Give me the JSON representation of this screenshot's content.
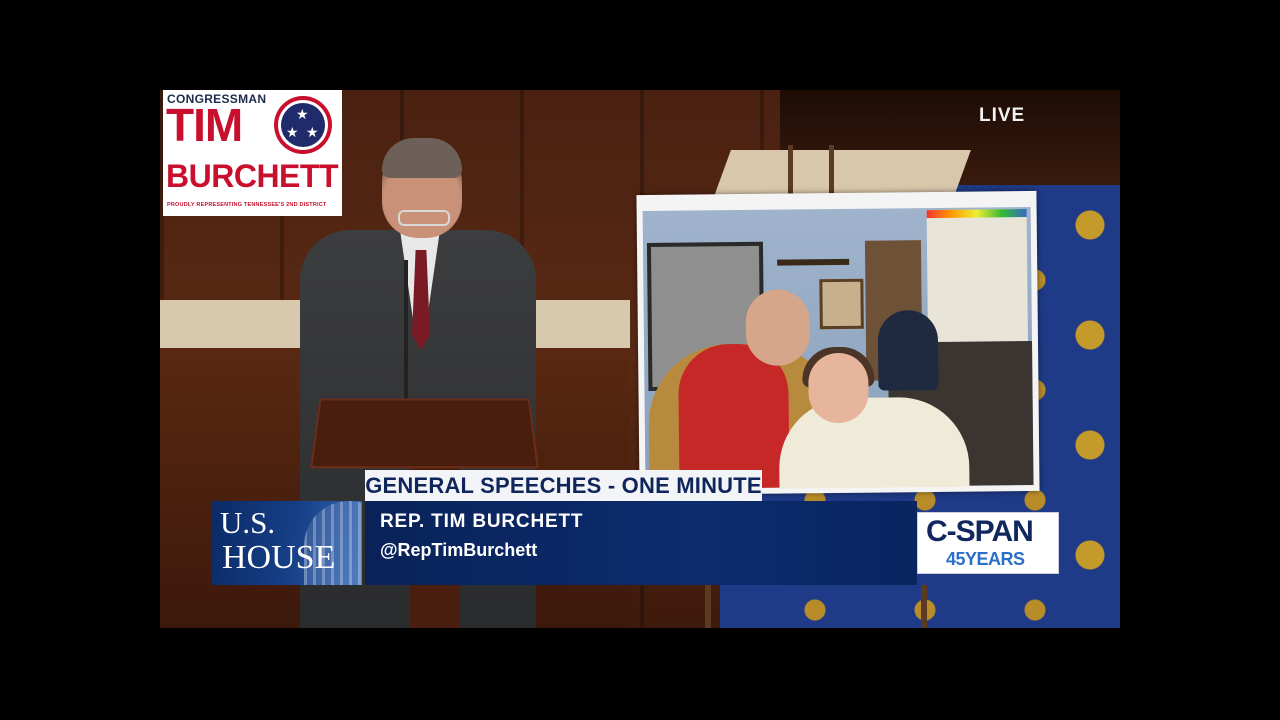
{
  "logo": {
    "line1": "CONGRESSMAN",
    "line2": "TIM",
    "line3": "BURCHETT",
    "tagline": "PROUDLY REPRESENTING TENNESSEE'S 2ND DISTRICT",
    "emblem": "tennessee-tristar-icon",
    "colors": {
      "red": "#c8102e",
      "navy": "#1f2b6b"
    }
  },
  "live_label": "LIVE",
  "lower_third": {
    "banner": "GENERAL SPEECHES - ONE MINUTE",
    "house_line1": "U.S.",
    "house_line2": "HOUSE",
    "speaker_name": "REP. TIM BURCHETT",
    "speaker_handle": "@RepTimBurchett",
    "network_name": "C-SPAN",
    "network_years": "45YEARS",
    "colors": {
      "navy": "#0a2258",
      "accent_blue": "#2b6fc9"
    }
  }
}
